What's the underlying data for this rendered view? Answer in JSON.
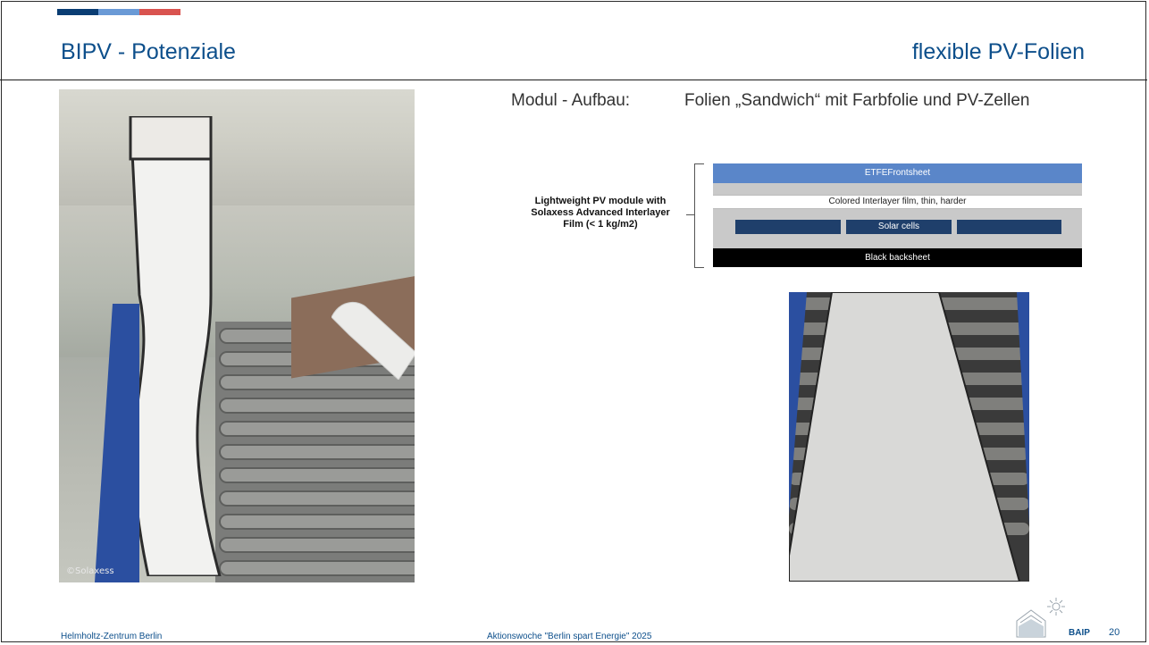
{
  "header": {
    "title_left": "BIPV - Potenziale",
    "title_right": "flexible PV-Folien"
  },
  "photo_left": {
    "credit": "©Solaxess"
  },
  "module": {
    "label": "Modul - Aufbau:",
    "value": "Folien „Sandwich“ mit Farbfolie und PV-Zellen"
  },
  "diagram": {
    "side_label": "Lightweight PV module with Solaxess Advanced Interlayer Film (< 1 kg/m2)",
    "layers": {
      "etfe": "ETFEFrontsheet",
      "colored": "Colored Interlayer film, thin, harder",
      "cells": "Solar cells",
      "backsheet": "Black backsheet"
    }
  },
  "footer": {
    "left": "Helmholtz-Zentrum Berlin",
    "center": "Aktionswoche \"Berlin spart Energie\" 2025",
    "brand": "BAIP",
    "page": "20"
  },
  "colors": {
    "title": "#0d4f8b",
    "accent_dark": "#0a3d73",
    "accent_light": "#6a9ad6",
    "accent_red": "#d9534f",
    "etfe": "#5a86c9",
    "cells": "#1f3f6b"
  }
}
